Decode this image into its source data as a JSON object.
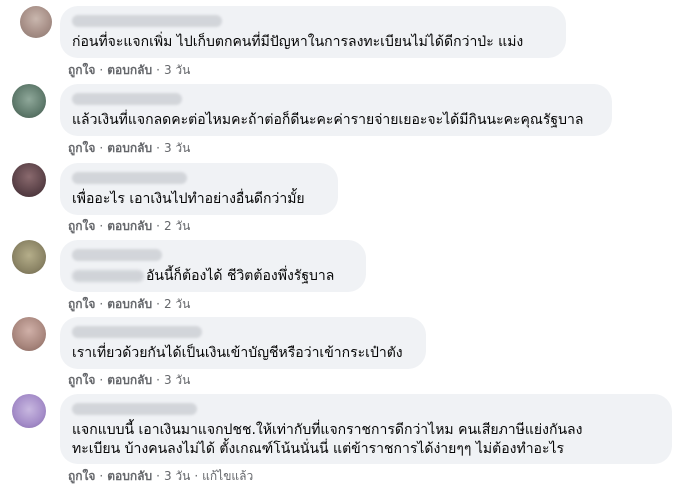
{
  "comments": [
    {
      "text": "ก่อนที่จะแจกเพิ่ม ไปเก็บตกคนที่มีปัญหาในการลงทะเบียนไม่ได้ดีกว่าป่ะ แม่ง",
      "like": "ถูกใจ",
      "reply": "ตอบกลับ",
      "time": "3 วัน"
    },
    {
      "text": "แล้วเงินที่แจกลดคะต่อไหมคะถ้าต่อก็ดีนะคะค่ารายจ่ายเยอะจะได้มีกินนะคะคุณรัฐบาล",
      "like": "ถูกใจ",
      "reply": "ตอบกลับ",
      "time": "3 วัน"
    },
    {
      "text": "เพื่ออะไร เอาเงินไปทำอย่างอื่นดีกว่ามั้ย",
      "like": "ถูกใจ",
      "reply": "ตอบกลับ",
      "time": "2 วัน"
    },
    {
      "text": "อันนี้ก็ต้องได้ ชีวิตต้องพึ่งรัฐบาล",
      "like": "ถูกใจ",
      "reply": "ตอบกลับ",
      "time": "2 วัน"
    },
    {
      "text": "เราเที่ยวด้วยกันได้เป็นเงินเข้าบัญชีหรือว่าเข้ากระเป๋าตัง",
      "like": "ถูกใจ",
      "reply": "ตอบกลับ",
      "time": "3 วัน"
    },
    {
      "text_line1": "แจกแบบนี้ เอาเงินมาแจกปชช.ให้เท่ากับที่แจกราชการดีกว่าไหม คนเสียภาษีแย่งกันลง",
      "text_line2": "ทะเบียน บ้างคนลงไม่ได้ ตั้งเกณฑ์โน้นนั่นนี่ แต่ข้าราชการได้ง่ายๆๆ ไม่ต้องทำอะไร",
      "like": "ถูกใจ",
      "reply": "ตอบกลับ",
      "time": "3 วัน",
      "edited": "แก้ไขแล้ว"
    }
  ],
  "colors": {
    "bubble": "#f0f2f5",
    "meta": "#65676b",
    "text": "#050505"
  }
}
